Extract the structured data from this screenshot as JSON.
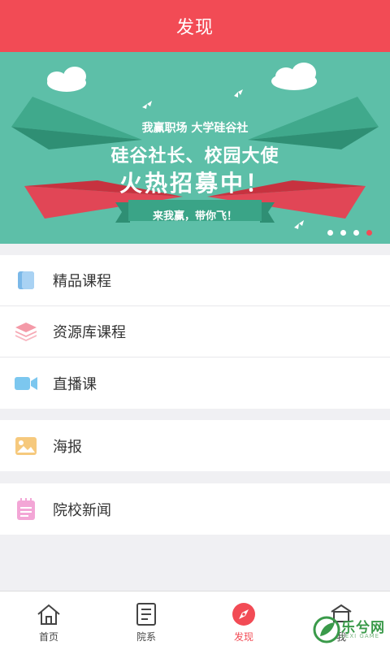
{
  "header": {
    "title": "发现"
  },
  "banner": {
    "line1": "我赢职场  大学硅谷社",
    "line2": "硅谷社长、校园大使",
    "line3": "火热招募中！",
    "ribbon": "来我赢，带你飞！",
    "page_count": 4,
    "active_index": 3
  },
  "menu_group_1": [
    {
      "label": "精品课程",
      "icon": "book-icon"
    },
    {
      "label": "资源库课程",
      "icon": "layers-icon"
    },
    {
      "label": "直播课",
      "icon": "video-camera-icon"
    }
  ],
  "menu_group_2": [
    {
      "label": "海报",
      "icon": "image-icon"
    }
  ],
  "menu_group_3": [
    {
      "label": "院校新闻",
      "icon": "notepad-icon"
    }
  ],
  "tabbar": {
    "items": [
      {
        "label": "首页",
        "icon": "home-icon"
      },
      {
        "label": "院系",
        "icon": "list-document-icon"
      },
      {
        "label": "发现",
        "icon": "compass-icon",
        "active": true
      },
      {
        "label": "我",
        "icon": "user-icon"
      }
    ]
  },
  "watermark": {
    "text": "乐兮网",
    "sub": "LEXI GAME"
  },
  "colors": {
    "primary": "#f24b55",
    "banner_bg": "#5dbfa8",
    "page_bg": "#f0f0f3"
  }
}
